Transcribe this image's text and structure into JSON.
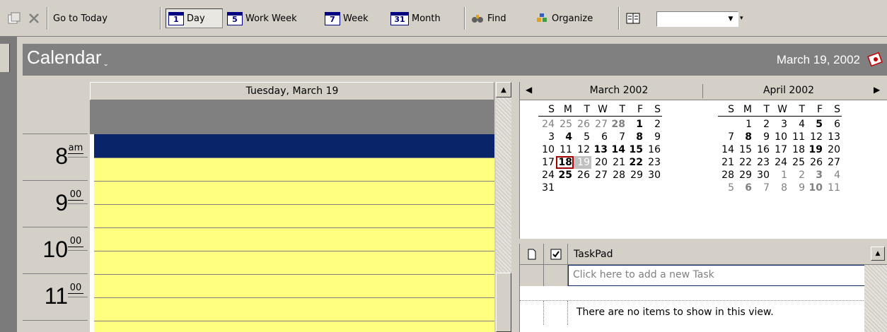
{
  "toolbar": {
    "go_to_today": "Go to Today",
    "day": "Day",
    "work_week": "Work Week",
    "week": "Week",
    "month": "Month",
    "find": "Find",
    "organize": "Organize",
    "day_num": "1",
    "work_week_num": "5",
    "week_num": "7",
    "month_num": "31",
    "search_value": ""
  },
  "banner": {
    "title": "Calendar",
    "date": "March 19, 2002"
  },
  "day_view": {
    "header": "Tuesday, March 19",
    "times": [
      {
        "hour": "8",
        "suffix": "am"
      },
      {
        "hour": "9",
        "suffix": "00"
      },
      {
        "hour": "10",
        "suffix": "00"
      },
      {
        "hour": "11",
        "suffix": "00"
      }
    ]
  },
  "navigator": {
    "months": [
      {
        "name": "March 2002",
        "dow": [
          "S",
          "M",
          "T",
          "W",
          "T",
          "F",
          "S"
        ],
        "weeks": [
          [
            {
              "d": "24",
              "s": "dim"
            },
            {
              "d": "25",
              "s": "dim"
            },
            {
              "d": "26",
              "s": "dim"
            },
            {
              "d": "27",
              "s": "dim"
            },
            {
              "d": "28",
              "s": "bold dim"
            },
            {
              "d": "1",
              "s": "bold"
            },
            {
              "d": "2",
              "s": ""
            }
          ],
          [
            {
              "d": "3",
              "s": ""
            },
            {
              "d": "4",
              "s": "bold"
            },
            {
              "d": "5",
              "s": ""
            },
            {
              "d": "6",
              "s": ""
            },
            {
              "d": "7",
              "s": ""
            },
            {
              "d": "8",
              "s": "bold"
            },
            {
              "d": "9",
              "s": ""
            }
          ],
          [
            {
              "d": "10",
              "s": ""
            },
            {
              "d": "11",
              "s": ""
            },
            {
              "d": "12",
              "s": ""
            },
            {
              "d": "13",
              "s": "bold"
            },
            {
              "d": "14",
              "s": "bold"
            },
            {
              "d": "15",
              "s": "bold"
            },
            {
              "d": "16",
              "s": ""
            }
          ],
          [
            {
              "d": "17",
              "s": ""
            },
            {
              "d": "18",
              "s": "bold today"
            },
            {
              "d": "19",
              "s": "sel"
            },
            {
              "d": "20",
              "s": ""
            },
            {
              "d": "21",
              "s": ""
            },
            {
              "d": "22",
              "s": "bold"
            },
            {
              "d": "23",
              "s": ""
            }
          ],
          [
            {
              "d": "24",
              "s": ""
            },
            {
              "d": "25",
              "s": "bold"
            },
            {
              "d": "26",
              "s": ""
            },
            {
              "d": "27",
              "s": ""
            },
            {
              "d": "28",
              "s": ""
            },
            {
              "d": "29",
              "s": ""
            },
            {
              "d": "30",
              "s": ""
            }
          ],
          [
            {
              "d": "31",
              "s": ""
            },
            {
              "d": "",
              "s": ""
            },
            {
              "d": "",
              "s": ""
            },
            {
              "d": "",
              "s": ""
            },
            {
              "d": "",
              "s": ""
            },
            {
              "d": "",
              "s": ""
            },
            {
              "d": "",
              "s": ""
            }
          ]
        ]
      },
      {
        "name": "April 2002",
        "dow": [
          "S",
          "M",
          "T",
          "W",
          "T",
          "F",
          "S"
        ],
        "weeks": [
          [
            {
              "d": "",
              "s": ""
            },
            {
              "d": "1",
              "s": ""
            },
            {
              "d": "2",
              "s": ""
            },
            {
              "d": "3",
              "s": ""
            },
            {
              "d": "4",
              "s": ""
            },
            {
              "d": "5",
              "s": "bold"
            },
            {
              "d": "6",
              "s": ""
            }
          ],
          [
            {
              "d": "7",
              "s": ""
            },
            {
              "d": "8",
              "s": "bold"
            },
            {
              "d": "9",
              "s": ""
            },
            {
              "d": "10",
              "s": ""
            },
            {
              "d": "11",
              "s": ""
            },
            {
              "d": "12",
              "s": ""
            },
            {
              "d": "13",
              "s": ""
            }
          ],
          [
            {
              "d": "14",
              "s": ""
            },
            {
              "d": "15",
              "s": ""
            },
            {
              "d": "16",
              "s": ""
            },
            {
              "d": "17",
              "s": ""
            },
            {
              "d": "18",
              "s": ""
            },
            {
              "d": "19",
              "s": "bold"
            },
            {
              "d": "20",
              "s": ""
            }
          ],
          [
            {
              "d": "21",
              "s": ""
            },
            {
              "d": "22",
              "s": ""
            },
            {
              "d": "23",
              "s": ""
            },
            {
              "d": "24",
              "s": ""
            },
            {
              "d": "25",
              "s": ""
            },
            {
              "d": "26",
              "s": ""
            },
            {
              "d": "27",
              "s": ""
            }
          ],
          [
            {
              "d": "28",
              "s": ""
            },
            {
              "d": "29",
              "s": ""
            },
            {
              "d": "30",
              "s": ""
            },
            {
              "d": "1",
              "s": "dim"
            },
            {
              "d": "2",
              "s": "dim"
            },
            {
              "d": "3",
              "s": "bold dim"
            },
            {
              "d": "4",
              "s": "dim"
            }
          ],
          [
            {
              "d": "5",
              "s": "dim"
            },
            {
              "d": "6",
              "s": "bold dim"
            },
            {
              "d": "7",
              "s": "dim"
            },
            {
              "d": "8",
              "s": "dim"
            },
            {
              "d": "9",
              "s": "dim"
            },
            {
              "d": "10",
              "s": "bold dim"
            },
            {
              "d": "11",
              "s": "dim"
            }
          ]
        ]
      }
    ]
  },
  "taskpad": {
    "title": "TaskPad",
    "new_task_placeholder": "Click here to add a new Task",
    "empty_message": "There are no items to show in this view."
  },
  "colors": {
    "chrome": "#d4d0c8",
    "banner": "#808080",
    "selection": "#0a246a",
    "work_hours": "#ffff80",
    "today_outline": "#a00000"
  }
}
